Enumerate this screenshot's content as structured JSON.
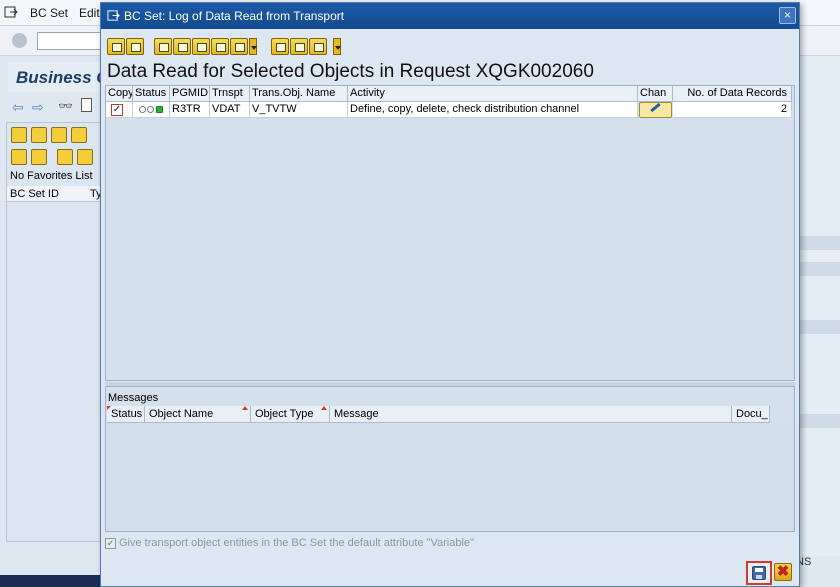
{
  "background": {
    "menu": [
      "BC Set",
      "Edit"
    ],
    "title": "Business C",
    "favorites_text": "No Favorites List",
    "columns": [
      "BC Set ID",
      "Ty"
    ],
    "status_text": "NS"
  },
  "dialog": {
    "title": "BC Set: Log of Data Read from Transport",
    "close_glyph": "×",
    "heading": "Data Read for Selected Objects in Request XQGK002060",
    "table": {
      "columns": [
        "Copy",
        "Status",
        "PGMID",
        "Trnspt",
        "Trans.Obj. Name",
        "Activity",
        "Chan",
        "No. of Data Records"
      ],
      "rows": [
        {
          "copy_mark": "✓",
          "status_icon": "status-green-light-icon",
          "pgmid": "R3TR",
          "trnspt": "VDAT",
          "trans_obj_name": "V_TVTW",
          "activity": "Define, copy, delete, check distribution channel",
          "chan_icon": "pencil-icon",
          "records": "2"
        }
      ]
    },
    "messages": {
      "title": "Messages",
      "columns": [
        "Status",
        "Object Name",
        "Object Type",
        "Message",
        "Docu_"
      ]
    },
    "variable_checkbox": {
      "checked_mark": "✓",
      "label": "Give transport object entities in the BC Set the default attribute \"Variable\""
    },
    "footer": {
      "save_icon": "save-icon",
      "cancel_glyph": "✖"
    }
  },
  "colors": {
    "titlebar": "#1b5aa8",
    "dialog_bg": "#dde7f1",
    "toolbar_icon": "#e9b819",
    "highlight_border": "#d23a2a"
  }
}
